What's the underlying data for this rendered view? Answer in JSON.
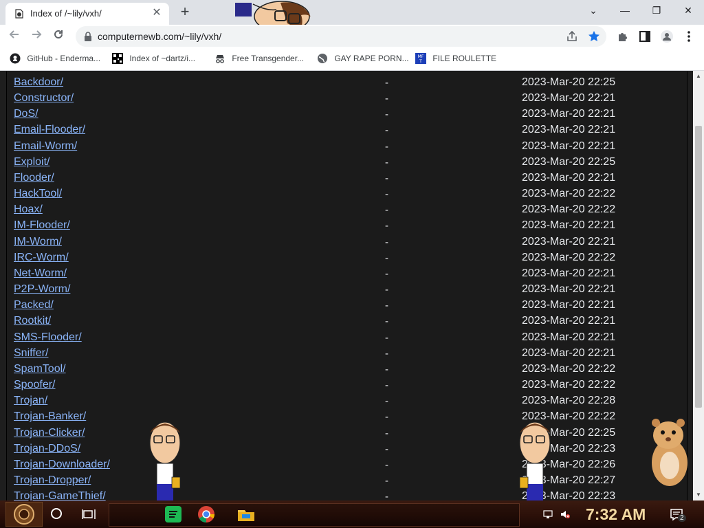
{
  "browser": {
    "tab_title": "Index of /~lily/vxh/",
    "url": "computernewb.com/~lily/vxh/",
    "new_tab_symbol": "+",
    "close_symbol": "✕",
    "window_controls": {
      "collapse": "⌄",
      "minimize": "—",
      "restore": "❐",
      "close": "✕"
    }
  },
  "bookmarks": [
    {
      "label": "GitHub - Enderma...",
      "icon": "github-icon"
    },
    {
      "label": "Index of ~dartz/i...",
      "icon": "qr-icon"
    },
    {
      "label": "Free Transgender...",
      "icon": "incognito-icon"
    },
    {
      "label": "GAY RAPE PORN...",
      "icon": "globe-icon"
    },
    {
      "label": "FILE ROULETTE",
      "icon": "mft-icon"
    }
  ],
  "listing": {
    "rows": [
      {
        "name": "Backdoor/",
        "size": "-",
        "date": "2023-Mar-20 22:25"
      },
      {
        "name": "Constructor/",
        "size": "-",
        "date": "2023-Mar-20 22:21"
      },
      {
        "name": "DoS/",
        "size": "-",
        "date": "2023-Mar-20 22:21"
      },
      {
        "name": "Email-Flooder/",
        "size": "-",
        "date": "2023-Mar-20 22:21"
      },
      {
        "name": "Email-Worm/",
        "size": "-",
        "date": "2023-Mar-20 22:21"
      },
      {
        "name": "Exploit/",
        "size": "-",
        "date": "2023-Mar-20 22:25"
      },
      {
        "name": "Flooder/",
        "size": "-",
        "date": "2023-Mar-20 22:21"
      },
      {
        "name": "HackTool/",
        "size": "-",
        "date": "2023-Mar-20 22:22"
      },
      {
        "name": "Hoax/",
        "size": "-",
        "date": "2023-Mar-20 22:22"
      },
      {
        "name": "IM-Flooder/",
        "size": "-",
        "date": "2023-Mar-20 22:21"
      },
      {
        "name": "IM-Worm/",
        "size": "-",
        "date": "2023-Mar-20 22:21"
      },
      {
        "name": "IRC-Worm/",
        "size": "-",
        "date": "2023-Mar-20 22:22"
      },
      {
        "name": "Net-Worm/",
        "size": "-",
        "date": "2023-Mar-20 22:21"
      },
      {
        "name": "P2P-Worm/",
        "size": "-",
        "date": "2023-Mar-20 22:21"
      },
      {
        "name": "Packed/",
        "size": "-",
        "date": "2023-Mar-20 22:21"
      },
      {
        "name": "Rootkit/",
        "size": "-",
        "date": "2023-Mar-20 22:21"
      },
      {
        "name": "SMS-Flooder/",
        "size": "-",
        "date": "2023-Mar-20 22:21"
      },
      {
        "name": "Sniffer/",
        "size": "-",
        "date": "2023-Mar-20 22:21"
      },
      {
        "name": "SpamTool/",
        "size": "-",
        "date": "2023-Mar-20 22:22"
      },
      {
        "name": "Spoofer/",
        "size": "-",
        "date": "2023-Mar-20 22:22"
      },
      {
        "name": "Trojan/",
        "size": "-",
        "date": "2023-Mar-20 22:28"
      },
      {
        "name": "Trojan-Banker/",
        "size": "-",
        "date": "2023-Mar-20 22:22"
      },
      {
        "name": "Trojan-Clicker/",
        "size": "-",
        "date": "2023-Mar-20 22:25"
      },
      {
        "name": "Trojan-DDoS/",
        "size": "-",
        "date": "2023-Mar-20 22:23"
      },
      {
        "name": "Trojan-Downloader/",
        "size": "-",
        "date": "2023-Mar-20 22:26"
      },
      {
        "name": "Trojan-Dropper/",
        "size": "-",
        "date": "2023-Mar-20 22:27"
      },
      {
        "name": "Trojan-GameThief/",
        "size": "-",
        "date": "2023-Mar-20 22:23"
      }
    ]
  },
  "taskbar": {
    "clock": "7:32 AM",
    "notification_count": "2"
  },
  "colors": {
    "link": "#8ab4f8",
    "page_bg": "#1b1b1b",
    "text": "#e8eaed",
    "clock": "#f3d9a2"
  }
}
